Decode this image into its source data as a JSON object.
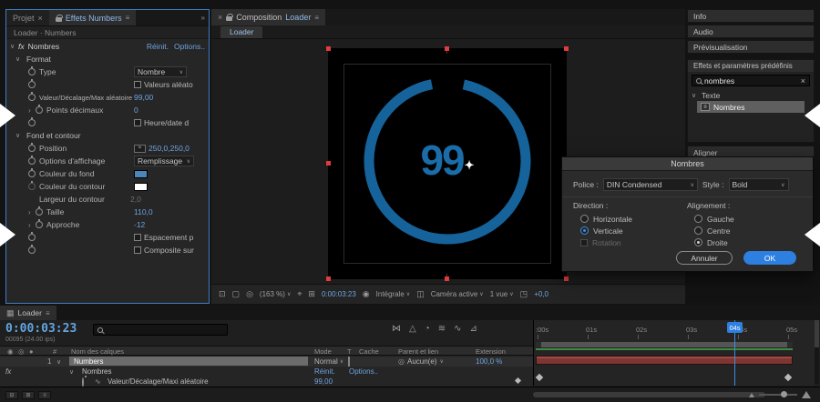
{
  "icons": {
    "close": "×",
    "menu": "≡",
    "overflow": "»",
    "twirl_down": "∨",
    "expand": "›",
    "dropdown": "∨",
    "crosshair": "⌖",
    "snapshot": "⊡",
    "monitor": "▢",
    "channels": "◎",
    "region": "⌖",
    "grid": "⊞",
    "camera": "◉",
    "mask": "◫",
    "pixel": "◳",
    "flowchart": "⋈",
    "draft": "△",
    "shy": "◔",
    "frame_blend": "≋",
    "motion_blur": "∿",
    "graph": "⊿",
    "pickwhip": "◎",
    "comp": "▦",
    "cursor_star": "✦",
    "tgl1": "⊟",
    "tgl2": "⊞",
    "tgl3": "≡"
  },
  "left_panel": {
    "tab_project": "Projet",
    "tab_effects": "Effets Numbers",
    "breadcrumb": "Loader · Numbers",
    "fx_badge": "fx",
    "effect_name": "Nombres",
    "reset": "Réinit.",
    "options": "Options..",
    "group_format": "Format",
    "group_background": "Fond et contour",
    "rows": {
      "type": {
        "label": "Type",
        "value": "Nombre"
      },
      "random": {
        "label": "Valeurs aléato"
      },
      "value": {
        "label": "Valeur/Décalage/Max aléatoire",
        "value": "99,00"
      },
      "decimals": {
        "label": "Points décimaux",
        "value": "0"
      },
      "time": {
        "label": "Heure/date d"
      },
      "position": {
        "label": "Position",
        "value": "250,0,250,0"
      },
      "display": {
        "label": "Options d'affichage",
        "value": "Remplissage"
      },
      "fill": {
        "label": "Couleur du fond"
      },
      "stroke": {
        "label": "Couleur du contour"
      },
      "stroke_width": {
        "label": "Largeur du contour",
        "value": "2,0"
      },
      "size": {
        "label": "Taille",
        "value": "110,0"
      },
      "tracking": {
        "label": "Approche",
        "value": "-12"
      },
      "spacing": {
        "label": "Espacement p"
      },
      "composite": {
        "label": "Composite sur"
      }
    },
    "fill_color": "#4a86b8",
    "stroke_color": "#ffffff"
  },
  "composition": {
    "tab_label": "Composition",
    "tab_name": "Loader",
    "nav_tab": "Loader",
    "number": "99",
    "loader_color": "#15639a",
    "toolbar": {
      "zoom": "(163 %)",
      "timecode": "0:00:03:23",
      "resolution": "Intégrale",
      "camera": "Caméra active",
      "views": "1 vue",
      "offset": "+0,0"
    }
  },
  "right_panel": {
    "info": "Info",
    "audio": "Audio",
    "preview": "Prévisualisation",
    "effects": "Effets et paramètres prédéfinis",
    "search_value": "nombres",
    "group": "Texte",
    "item": "Nombres",
    "align": "Aligner"
  },
  "dialog": {
    "title": "Nombres",
    "font_label": "Police :",
    "font_value": "DIN Condensed",
    "style_label": "Style :",
    "style_value": "Bold",
    "direction_label": "Direction :",
    "alignment_label": "Alignement :",
    "dir_horizontal": "Horizontale",
    "dir_vertical": "Verticale",
    "rotation": "Rotation",
    "align_left": "Gauche",
    "align_center": "Centre",
    "align_right": "Droite",
    "cancel": "Annuler",
    "ok": "OK"
  },
  "timeline": {
    "tab": "Loader",
    "timecode": "0:00:03:23",
    "frames": "00095 (24.00 ips)",
    "ruler": [
      ":00s",
      "01s",
      "02s",
      "03s",
      "04s",
      "05s"
    ],
    "columns": {
      "num": "#",
      "name": "Nom des calques",
      "mode": "Mode",
      "t": "T",
      "cache": "Cache",
      "parent": "Parent et lien",
      "stretch": "Extension"
    },
    "layer": {
      "num": "1",
      "name": "Numbers",
      "mode": "Normal",
      "parent": "Aucun(e)",
      "stretch": "100,0 %"
    },
    "fx_gutter": "fx",
    "effect": {
      "name": "Nombres",
      "reset": "Réinit.",
      "options": "Options.."
    },
    "property": {
      "label": "Valeur/Décalage/Maxi aléatoire",
      "value": "99,00"
    }
  }
}
